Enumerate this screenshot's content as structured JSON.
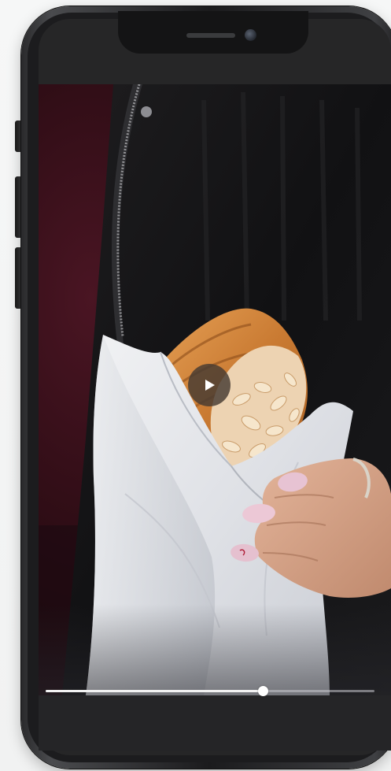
{
  "player": {
    "state": "paused",
    "progress_fraction": 0.66
  },
  "icons": {
    "play": "play-icon",
    "camera": "front-camera-icon",
    "speaker": "earpiece-speaker-icon"
  },
  "colors": {
    "phone_frame": "#1c1c1e",
    "video_background": "#2a0e15",
    "progress_track": "#c8c8cd",
    "progress_fill": "#f2f2f2",
    "play_button": "#463a32"
  }
}
